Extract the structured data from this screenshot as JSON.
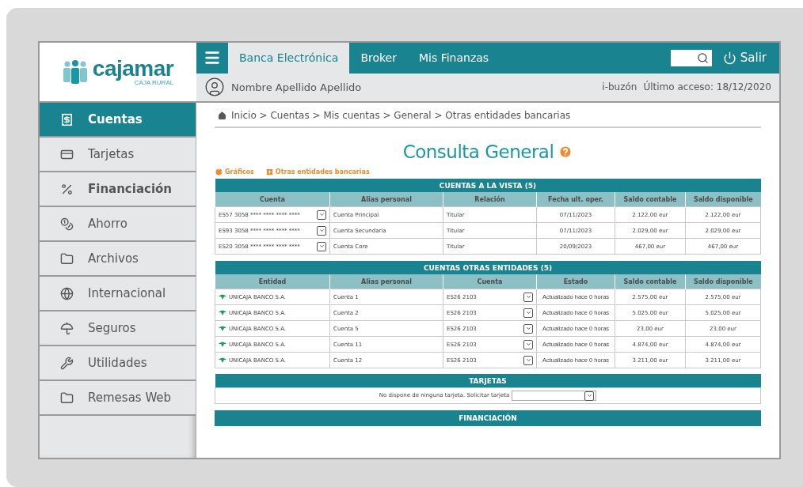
{
  "logo": {
    "name": "cajamar",
    "tagline": "CAJA RURAL"
  },
  "nav": {
    "tabs": [
      {
        "label": "Banca Electrónica",
        "selected": true
      },
      {
        "label": "Broker",
        "selected": false
      },
      {
        "label": "Mis Finanzas",
        "selected": false
      }
    ],
    "exit": "Salir"
  },
  "user": {
    "name": "Nombre Apellido Apellido",
    "mailbox": "i-buzón",
    "last_access": "Último acceso: 18/12/2020"
  },
  "sidebar": {
    "items": [
      {
        "label": "Cuentas",
        "selected": true,
        "bold": true
      },
      {
        "label": "Tarjetas",
        "selected": false,
        "bold": false
      },
      {
        "label": "Financiación",
        "selected": false,
        "bold": true
      },
      {
        "label": "Ahorro",
        "selected": false,
        "bold": false
      },
      {
        "label": "Archivos",
        "selected": false,
        "bold": false
      },
      {
        "label": "Internacional",
        "selected": false,
        "bold": false
      },
      {
        "label": "Seguros",
        "selected": false,
        "bold": false
      },
      {
        "label": "Utilidades",
        "selected": false,
        "bold": false
      },
      {
        "label": "Remesas Web",
        "selected": false,
        "bold": false
      }
    ]
  },
  "breadcrumb": "Inicio > Cuentas > Mis cuentas > General > Otras entidades bancarias",
  "title": "Consulta General",
  "actions": [
    {
      "label": "Gráficos",
      "kind": "chart"
    },
    {
      "label": "Otras entidades bancarias",
      "kind": "add"
    }
  ],
  "tables": [
    {
      "title": "CUENTAS A LA VISTA (5)",
      "columns": [
        {
          "label": "Cuenta",
          "kind": "select"
        },
        {
          "label": "Alias personal",
          "kind": "text"
        },
        {
          "label": "Relación",
          "kind": "text"
        },
        {
          "label": "Fecha ult. oper.",
          "kind": "center"
        },
        {
          "label": "Saldo contable",
          "kind": "amount"
        },
        {
          "label": "Saldo disponible",
          "kind": "amount"
        }
      ],
      "rows": [
        [
          "ES57 3058 **** **** **** ****",
          "Cuenta Principal",
          "Titular",
          "07/11/2023",
          "2.122,00 eur",
          "2.122,00 eur"
        ],
        [
          "ES93 3058 **** **** **** ****",
          "Cuenta Secundaria",
          "Titular",
          "07/11/2023",
          "2.029,00 eur",
          "2.029,00 eur"
        ],
        [
          "ES20 3058 **** **** **** ****",
          "Cuenta Core",
          "Titular",
          "20/09/2023",
          "467,00 eur",
          "467,00 eur"
        ]
      ]
    },
    {
      "title": "CUENTAS OTRAS ENTIDADES (5)",
      "columns": [
        {
          "label": "Entidad",
          "kind": "bank"
        },
        {
          "label": "Alias personal",
          "kind": "text"
        },
        {
          "label": "Cuenta",
          "kind": "select"
        },
        {
          "label": "Estado",
          "kind": "status"
        },
        {
          "label": "Saldo contable",
          "kind": "amount"
        },
        {
          "label": "Saldo disponible",
          "kind": "amount"
        }
      ],
      "rows": [
        [
          "UNICAJA BANCO S.A.",
          "Cuenta 1",
          "ES26 2103",
          "Actualizado hace 0 horas",
          "2.575,00 eur",
          "2.575,00 eur"
        ],
        [
          "UNICAJA BANCO S.A.",
          "Cuenta 2",
          "ES26 2103",
          "Actualizado hace 0 horas",
          "5.025,00 eur",
          "5.025,00 eur"
        ],
        [
          "UNICAJA BANCO S.A.",
          "Cuenta 5",
          "ES26 2103",
          "Actualizado hace 0 horas",
          "23,00 eur",
          "23,00 eur"
        ],
        [
          "UNICAJA BANCO S.A.",
          "Cuenta 11",
          "ES26 2103",
          "Actualizado hace 0 horas",
          "4.874,00 eur",
          "4.874,00 eur"
        ],
        [
          "UNICAJA BANCO S.A.",
          "Cuenta 12",
          "ES26 2103",
          "Actualizado hace 0 horas",
          "3.211,00 eur",
          "3.211,00 eur"
        ]
      ]
    }
  ],
  "cards": {
    "title": "TARJETAS",
    "message": "No dispone de ninguna tarjeta. Solicitar tarjeta"
  },
  "financing": {
    "title": "FINANCIACIÓN"
  }
}
